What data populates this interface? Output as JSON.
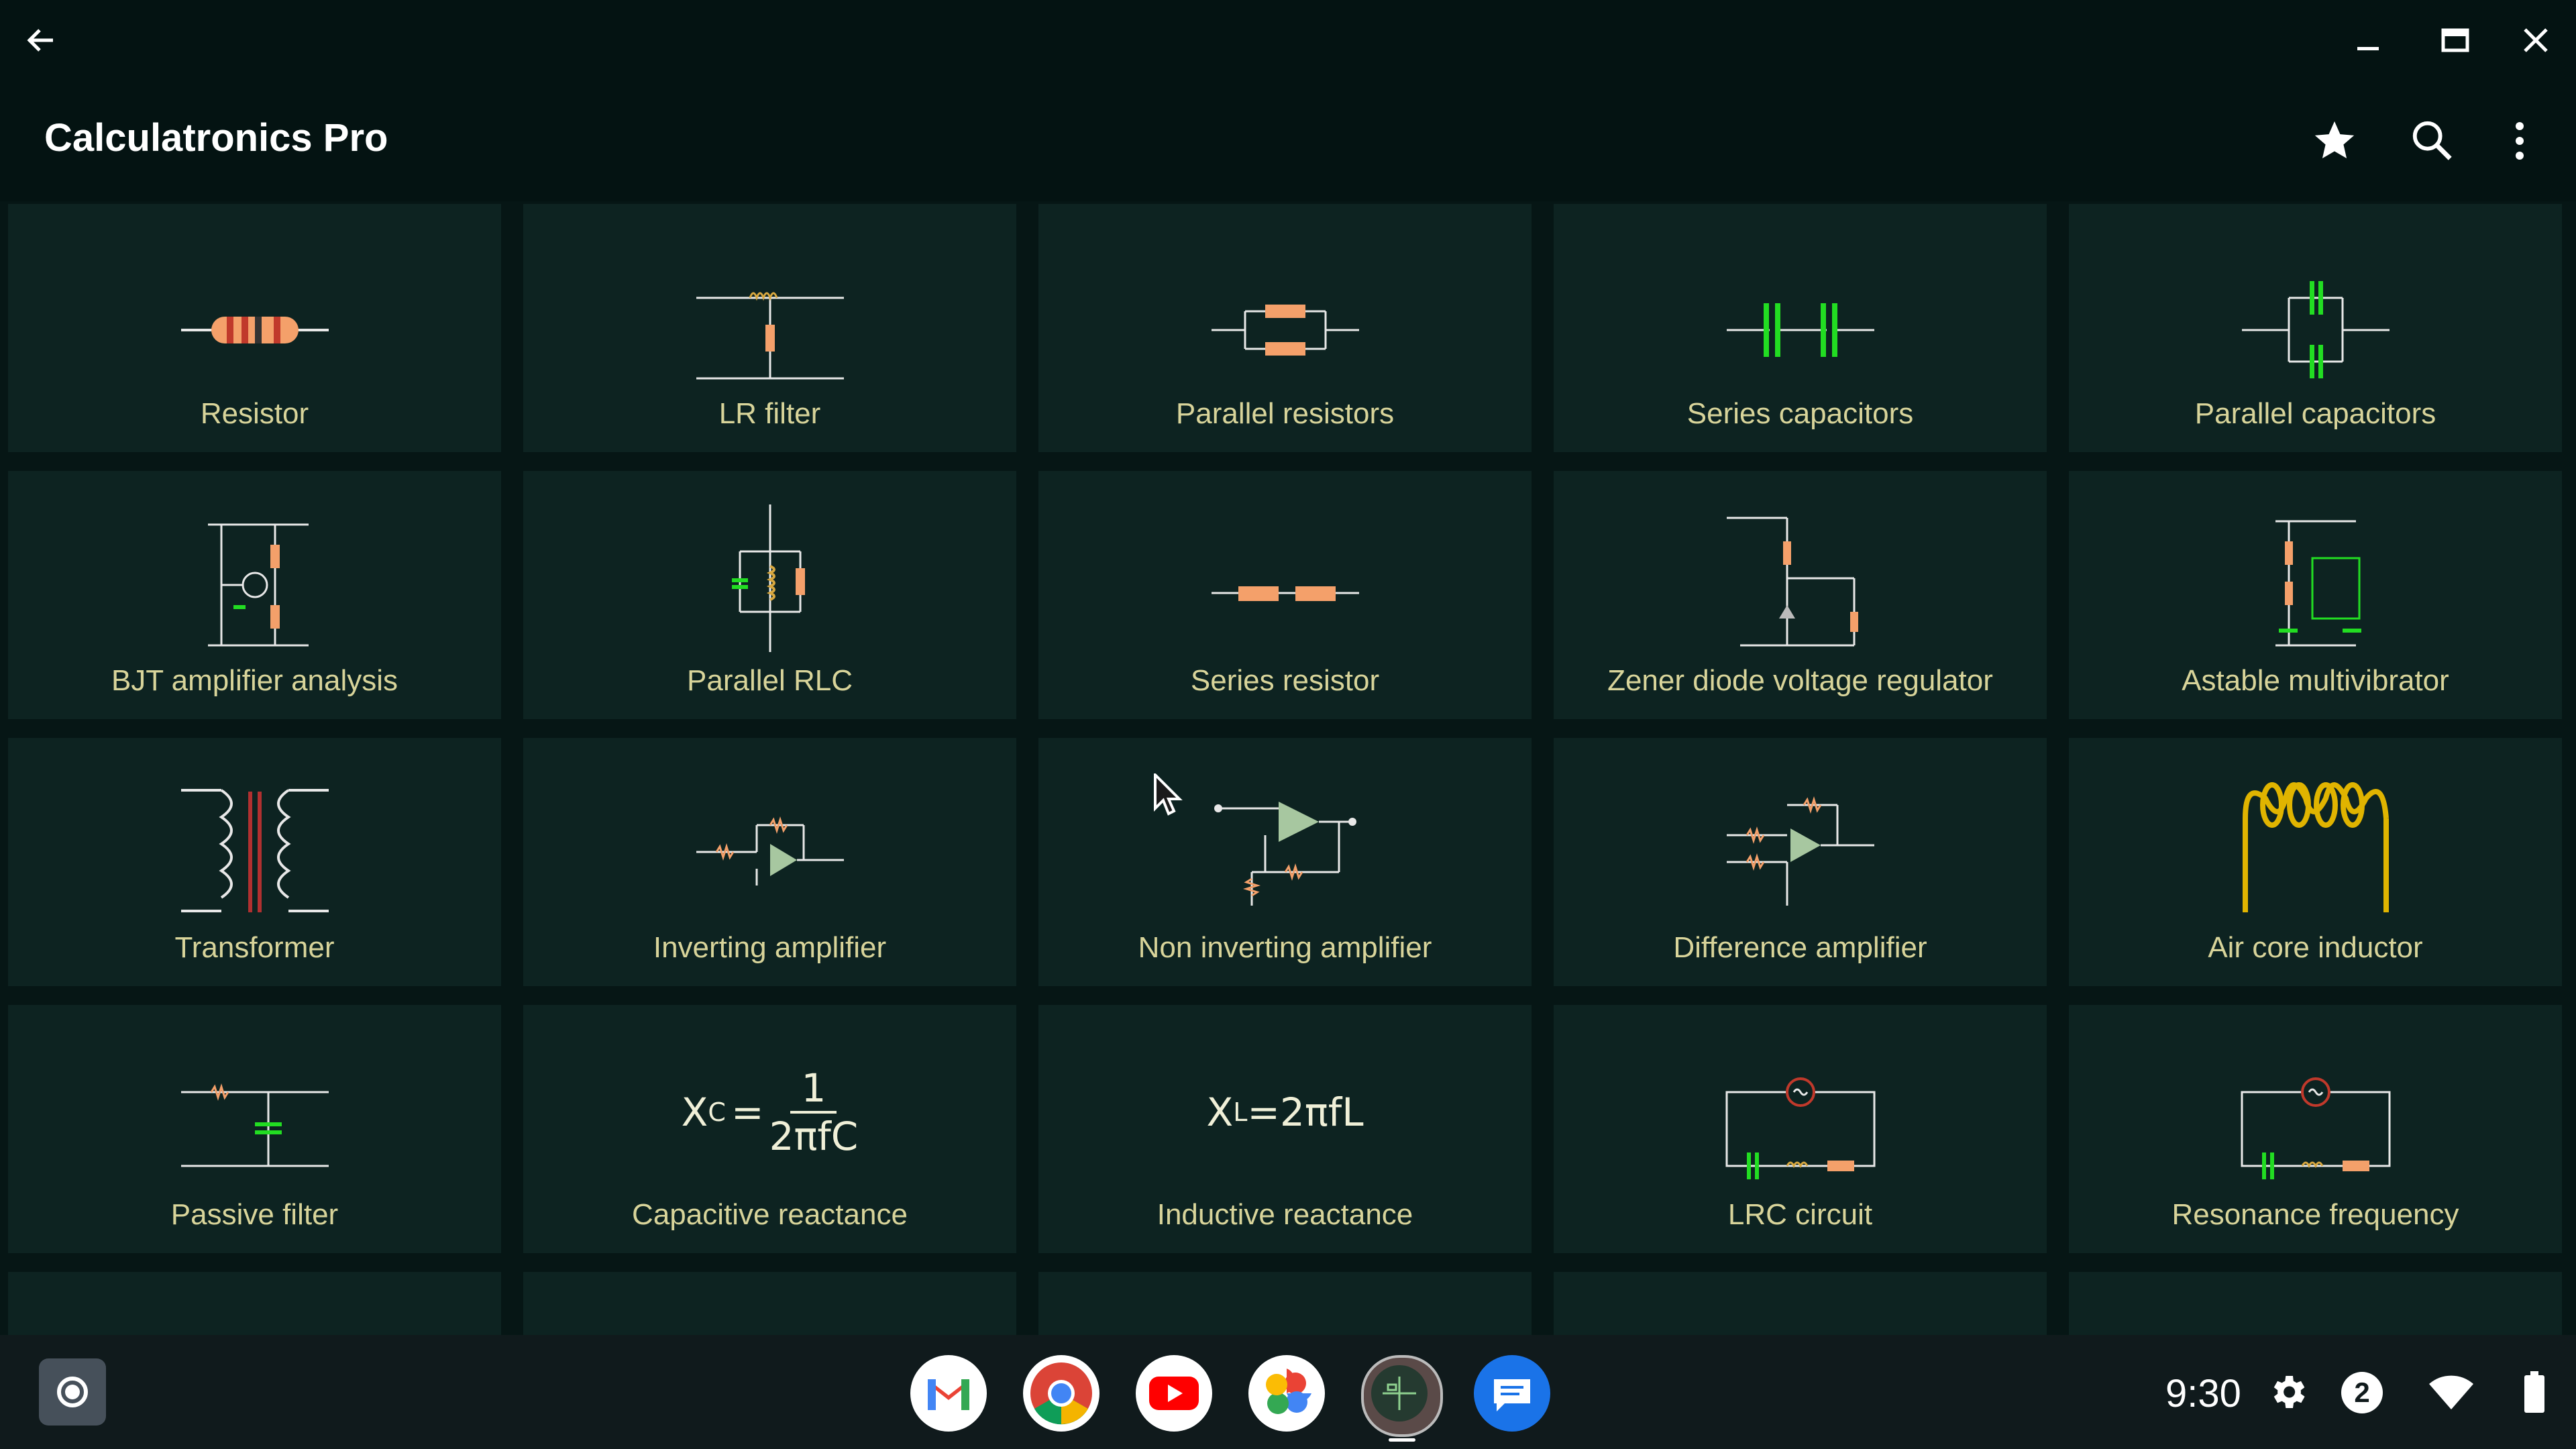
{
  "app": {
    "title": "Calculatronics Pro"
  },
  "titlebar": {
    "back_icon": "back-arrow-icon",
    "minimize_icon": "minimize-icon",
    "maximize_icon": "maximize-icon",
    "close_icon": "close-icon"
  },
  "toolbar": {
    "favorites_icon": "star-icon",
    "search_icon": "search-icon",
    "menu_icon": "more-vert-icon"
  },
  "tiles": [
    {
      "label": "Resistor",
      "icon": "resistor-icon"
    },
    {
      "label": "LR filter",
      "icon": "lr-filter-icon"
    },
    {
      "label": "Parallel resistors",
      "icon": "parallel-resistors-icon"
    },
    {
      "label": "Series capacitors",
      "icon": "series-capacitors-icon"
    },
    {
      "label": "Parallel capacitors",
      "icon": "parallel-capacitors-icon"
    },
    {
      "label": "BJT amplifier analysis",
      "icon": "bjt-amplifier-icon"
    },
    {
      "label": "Parallel RLC",
      "icon": "parallel-rlc-icon"
    },
    {
      "label": "Series resistor",
      "icon": "series-resistor-icon"
    },
    {
      "label": "Zener diode voltage regulator",
      "icon": "zener-regulator-icon"
    },
    {
      "label": "Astable multivibrator",
      "icon": "astable-multivibrator-icon"
    },
    {
      "label": "Transformer",
      "icon": "transformer-icon"
    },
    {
      "label": "Inverting amplifier",
      "icon": "inverting-amplifier-icon"
    },
    {
      "label": "Non inverting amplifier",
      "icon": "non-inverting-amplifier-icon"
    },
    {
      "label": "Difference amplifier",
      "icon": "difference-amplifier-icon"
    },
    {
      "label": "Air core inductor",
      "icon": "air-core-inductor-icon"
    },
    {
      "label": "Passive filter",
      "icon": "passive-filter-icon"
    },
    {
      "label": "Capacitive reactance",
      "icon": "capacitive-reactance-formula-icon"
    },
    {
      "label": "Inductive reactance",
      "icon": "inductive-reactance-formula-icon"
    },
    {
      "label": "LRC circuit",
      "icon": "lrc-circuit-icon"
    },
    {
      "label": "Resonance frequency",
      "icon": "resonance-frequency-icon"
    }
  ],
  "formulas": {
    "xc_lhs": "X",
    "xc_sub": "C",
    "xc_eq": "=",
    "xc_num": "1",
    "xc_den": "2πfC",
    "xl_lhs": "X",
    "xl_sub": "L",
    "xl_rhs": "=2πfL"
  },
  "shelf": {
    "time": "9:30",
    "notification_count": "2",
    "apps": [
      {
        "name": "gmail",
        "icon": "gmail-icon"
      },
      {
        "name": "chrome",
        "icon": "chrome-icon"
      },
      {
        "name": "youtube",
        "icon": "youtube-icon"
      },
      {
        "name": "photos",
        "icon": "photos-icon"
      },
      {
        "name": "calculatronics",
        "icon": "calculatronics-icon"
      },
      {
        "name": "messages",
        "icon": "messages-icon"
      }
    ]
  },
  "colors": {
    "background": "#061615",
    "tile": "#0d2321",
    "label": "#d8d49a",
    "component_orange": "#f4a06a",
    "capacitor_green": "#22dd22",
    "inductor_gold": "#e0b400"
  }
}
